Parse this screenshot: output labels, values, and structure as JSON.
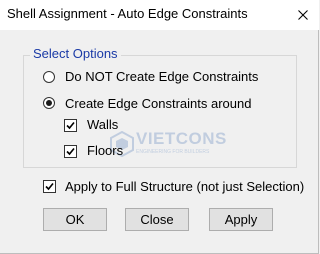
{
  "window": {
    "title": "Shell Assignment - Auto Edge Constraints",
    "close_icon": "close-icon"
  },
  "group": {
    "legend": "Select Options",
    "options": [
      {
        "label": "Do NOT Create Edge Constraints",
        "selected": false
      },
      {
        "label": "Create Edge Constraints around",
        "selected": true
      }
    ],
    "sub_options": [
      {
        "label": "Walls",
        "checked": true
      },
      {
        "label": "Floors",
        "checked": true
      }
    ]
  },
  "apply_full": {
    "label": "Apply to Full Structure (not just Selection)",
    "checked": true
  },
  "buttons": {
    "ok": "OK",
    "close": "Close",
    "apply": "Apply"
  },
  "watermark": {
    "name": "VIETCONS",
    "tagline": "ENGINEERING FOR BUILDERS",
    "color": "#1f57a6"
  }
}
